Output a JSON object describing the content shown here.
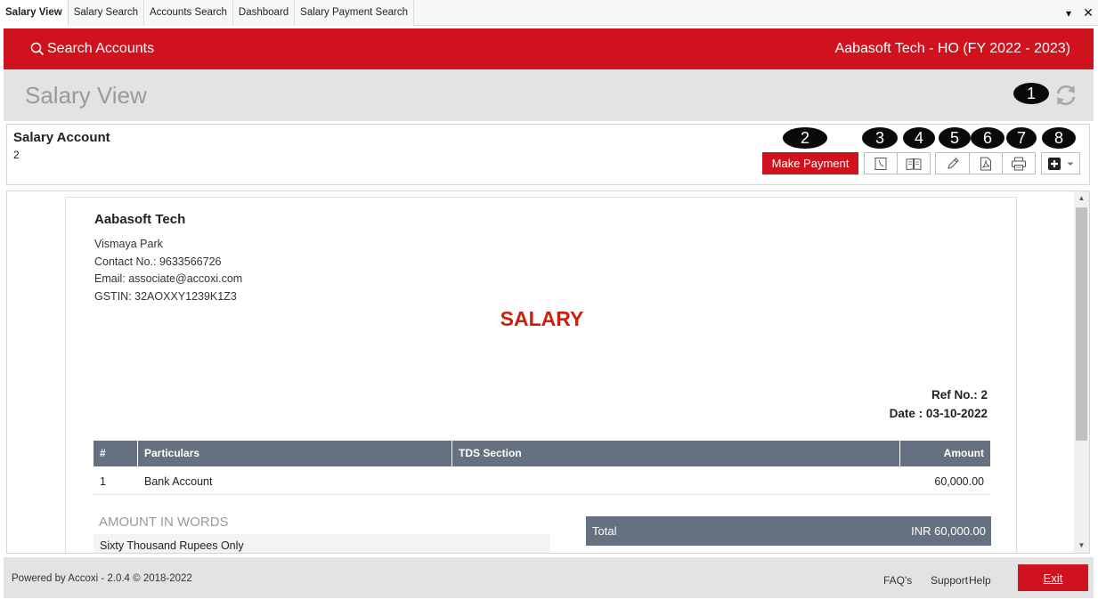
{
  "tabs": [
    {
      "label": "Salary View",
      "active": true
    },
    {
      "label": "Salary Search",
      "active": false
    },
    {
      "label": "Accounts Search",
      "active": false
    },
    {
      "label": "Dashboard",
      "active": false
    },
    {
      "label": "Salary Payment Search",
      "active": false
    }
  ],
  "tab_controls": {
    "dropdown": "▾",
    "close": "✕"
  },
  "header": {
    "search_label": "Search Accounts",
    "company": "Aabasoft Tech - HO (FY 2022 - 2023)",
    "brand_color": "#d0121e"
  },
  "page": {
    "title": "Salary View"
  },
  "markers": [
    "1",
    "2",
    "3",
    "4",
    "5",
    "6",
    "7",
    "8"
  ],
  "account": {
    "label": "Salary Account",
    "value": "2",
    "make_payment_label": "Make Payment"
  },
  "toolbar_icons": [
    "history-icon",
    "ledger-book-icon",
    "edit-pencil-icon",
    "pdf-icon",
    "print-icon",
    "add-plus-icon"
  ],
  "document": {
    "company": "Aabasoft Tech",
    "address": "Vismaya Park",
    "contact": "Contact No.: 9633566726",
    "email": "Email: associate@accoxi.com",
    "gstin": "GSTIN: 32AOXXY1239K1Z3",
    "heading": "SALARY",
    "ref": "Ref No.: 2",
    "date": "Date : 03-10-2022",
    "table": {
      "columns": [
        "#",
        "Particulars",
        "TDS Section",
        "Amount"
      ],
      "rows": [
        {
          "no": "1",
          "particulars": "Bank Account",
          "tds": "",
          "amount": "60,000.00"
        }
      ]
    },
    "amount_in_words_label": "AMOUNT IN WORDS",
    "amount_in_words": "Sixty Thousand Rupees Only",
    "total_label": "Total",
    "total_value": "INR 60,000.00"
  },
  "footer": {
    "powered": "Powered by Accoxi - 2.0.4 © 2018-2022",
    "links": [
      "FAQ's",
      "Support",
      "Help"
    ],
    "exit_label": "Exit"
  }
}
